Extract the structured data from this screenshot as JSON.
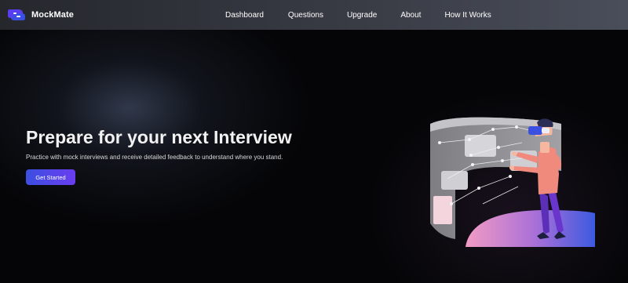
{
  "brand": {
    "name": "MockMate",
    "logo_icon": "mockmate-logo-icon"
  },
  "nav": {
    "items": [
      {
        "label": "Dashboard"
      },
      {
        "label": "Questions"
      },
      {
        "label": "Upgrade"
      },
      {
        "label": "About"
      },
      {
        "label": "How It Works"
      }
    ]
  },
  "hero": {
    "title": "Prepare for your next Interview",
    "subtitle": "Practice with mock interviews and receive detailed feedback to understand where you stand.",
    "cta_label": "Get Started",
    "illustration_icon": "vr-interview-illustration"
  },
  "colors": {
    "accent_start": "#3b4fe0",
    "accent_end": "#6a3df0",
    "background": "#050507",
    "navbar": "#3a3d46"
  }
}
